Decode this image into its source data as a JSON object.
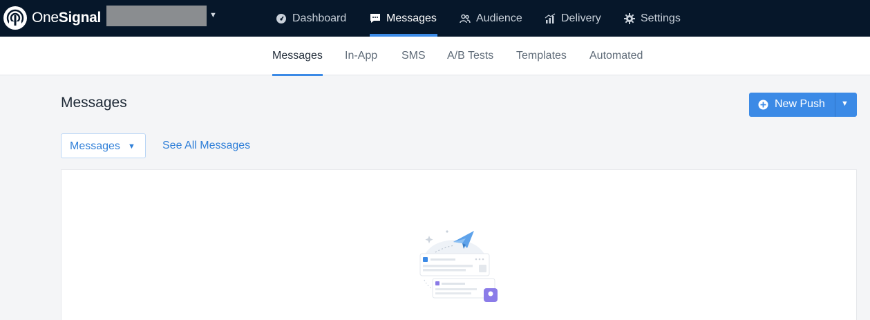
{
  "brand": {
    "name_part1": "One",
    "name_part2": "Signal"
  },
  "colors": {
    "nav_bg": "#06172a",
    "accent": "#3b8ae6",
    "link": "#2f7fd8"
  },
  "main_nav": [
    {
      "label": "Dashboard",
      "icon": "dashboard-icon",
      "active": false
    },
    {
      "label": "Messages",
      "icon": "chat-bubble-icon",
      "active": true
    },
    {
      "label": "Audience",
      "icon": "people-icon",
      "active": false
    },
    {
      "label": "Delivery",
      "icon": "bar-chart-icon",
      "active": false
    },
    {
      "label": "Settings",
      "icon": "gear-icon",
      "active": false
    }
  ],
  "sub_nav": [
    {
      "label": "Messages",
      "active": true
    },
    {
      "label": "In-App",
      "active": false
    },
    {
      "label": "SMS",
      "active": false
    },
    {
      "label": "A/B Tests",
      "active": false
    },
    {
      "label": "Templates",
      "active": false
    },
    {
      "label": "Automated",
      "active": false
    }
  ],
  "page": {
    "title": "Messages",
    "new_push_label": "New Push",
    "filter_label": "Messages",
    "see_all_label": "See All Messages"
  }
}
